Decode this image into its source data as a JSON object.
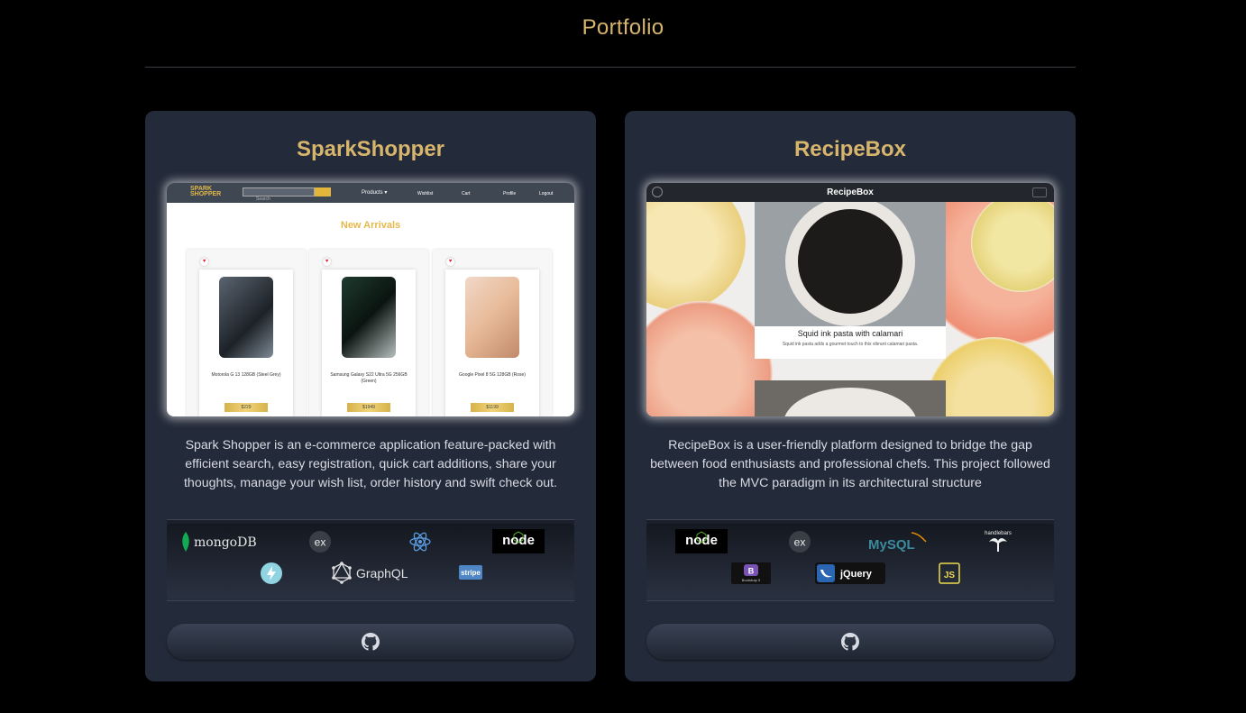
{
  "page": {
    "title": "Portfolio"
  },
  "projects": [
    {
      "title": "SparkShopper",
      "screenshot": {
        "logo_line1": "SPARK",
        "logo_line2": "SHOPPER",
        "search_placeholder": "Search",
        "nav": [
          "Products ▾",
          "Wishlist",
          "Cart",
          "Profile",
          "Logout"
        ],
        "heading": "New Arrivals",
        "products": [
          {
            "name": "Motorola G 13 128GB (Steel Grey)",
            "price": "$229"
          },
          {
            "name": "Samsung Galaxy S22 Ultra 5G 256GB (Green)",
            "price": "$1949"
          },
          {
            "name": "Google Pixel 8 5G 128GB (Rose)",
            "price": "$1199"
          }
        ]
      },
      "description": "Spark Shopper is an e-commerce application feature-packed with efficient search, easy registration, quick cart additions, share your thoughts, manage your wish list, order history and swift check out.",
      "tech": [
        "mongoDB",
        "ex",
        "React",
        "node",
        "Apollo",
        "GraphQL",
        "stripe"
      ],
      "github_icon": "github-icon"
    },
    {
      "title": "RecipeBox",
      "screenshot": {
        "nav_title": "RecipeBox",
        "recipe_title": "Squid ink pasta with calamari",
        "recipe_sub": "Squid ink pasta adds a gourmet touch to this vibrant calamari pasta."
      },
      "description": "RecipeBox is a user-friendly platform designed to bridge the gap between food enthusiasts and professional chefs. This project followed the MVC paradigm in its architectural structure",
      "tech": [
        "node",
        "ex",
        "MySQL",
        "handlebars",
        "Bootstrap 5",
        "jQuery",
        "JS"
      ],
      "github_icon": "github-icon"
    }
  ],
  "colors": {
    "accent": "#d7b56d",
    "card_bg": "#232a39",
    "page_bg": "#000000"
  }
}
